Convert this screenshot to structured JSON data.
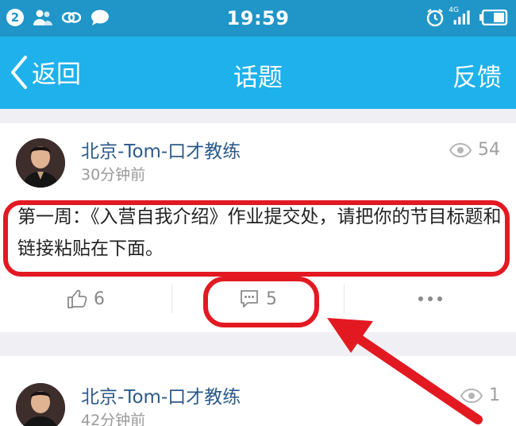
{
  "status_bar": {
    "notification_count": "2",
    "time": "19:59",
    "network": "4G",
    "icons": [
      "contacts-icon",
      "link-icon",
      "chat-icon",
      "alarm-icon",
      "signal-icon",
      "battery-icon"
    ]
  },
  "navbar": {
    "back_label": "返回",
    "title": "话题",
    "feedback_label": "反馈"
  },
  "posts": [
    {
      "author": "北京-Tom-口才教练",
      "time": "30分钟前",
      "views": "54",
      "text": "第一周：《入营自我介绍》作业提交处，请把你的节目标题和链接粘贴在下面。",
      "likes": "6",
      "comments": "5"
    },
    {
      "author": "北京-Tom-口才教练",
      "time": "42分钟前",
      "views": "1"
    }
  ],
  "colors": {
    "status_bar": "#1f95c8",
    "nav_bar": "#1fb1ec",
    "author": "#2c5a8a",
    "annotation": "#e31922"
  }
}
